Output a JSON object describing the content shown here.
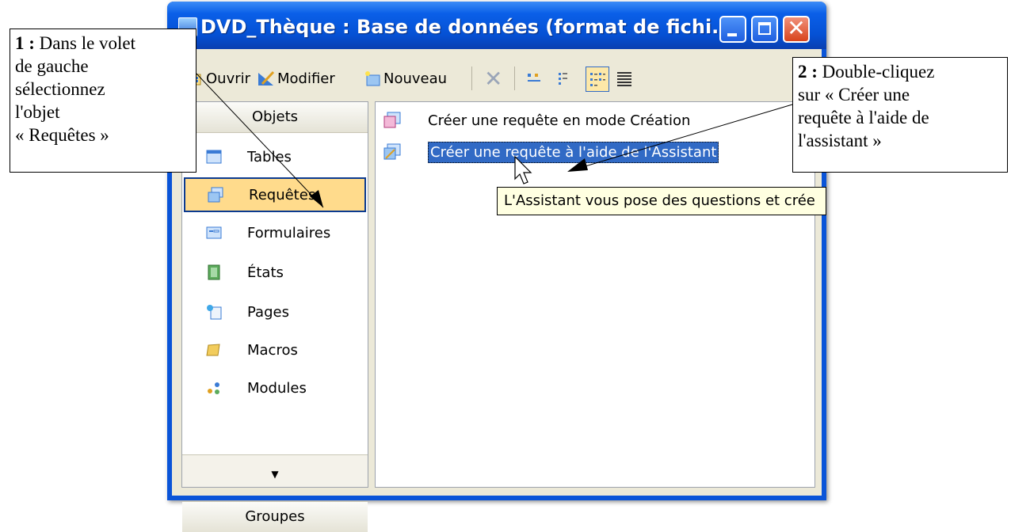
{
  "window": {
    "title": "DVD_Thèque : Base de données (format de fichi..."
  },
  "toolbar": {
    "open": "Ouvrir",
    "modify": "Modifier",
    "new": "Nouveau"
  },
  "objects_pane": {
    "header": "Objets",
    "items": [
      "Tables",
      "Requêtes",
      "Formulaires",
      "États",
      "Pages",
      "Macros",
      "Modules"
    ],
    "selected": "Requêtes",
    "groups_header": "Groupes"
  },
  "list": {
    "items": [
      "Créer une requête en mode Création",
      "Créer une requête à l'aide de l'Assistant"
    ],
    "selected_index": 1
  },
  "tooltip": "L'Assistant vous pose des questions et crée",
  "callouts": {
    "step1_number": "1 :",
    "step1_line1": " Dans le volet",
    "step1_line2": "de gauche",
    "step1_line3": "sélectionnez",
    "step1_line4": "l'objet",
    "step1_line5": "« Requêtes »",
    "step2_number": "2 :",
    "step2_line1": " Double-cliquez",
    "step2_line2": "sur « Créer une",
    "step2_line3": "requête à l'aide de",
    "step2_line4": "l'assistant »"
  },
  "colors": {
    "titlebar": "#0551d4",
    "selection": "#316ac5",
    "nav_selected": "#ffdb8c",
    "tooltip_bg": "#ffffe1"
  }
}
